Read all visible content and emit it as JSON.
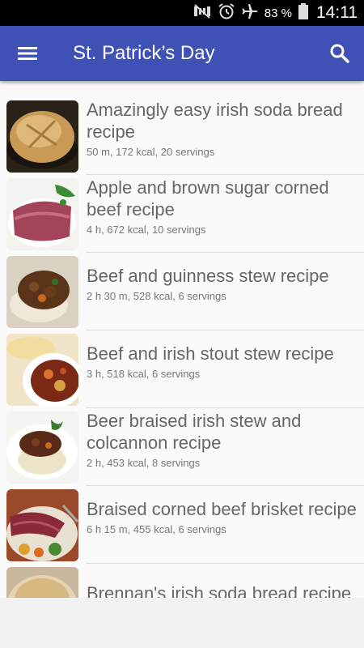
{
  "status_bar": {
    "battery_percent": "83 %",
    "time": "14:11",
    "icons": [
      "mute-icon",
      "alarm-icon",
      "airplane-icon",
      "battery-icon"
    ]
  },
  "app_bar": {
    "title": "St. Patrick’s Day",
    "menu_icon": "hamburger-menu-icon",
    "search_icon": "search-icon",
    "color": "#3f51b5"
  },
  "recipes": [
    {
      "title": "Amazingly easy irish soda bread recipe",
      "meta": "50 m, 172 kcal, 20 servings"
    },
    {
      "title": "Apple and brown sugar corned beef recipe",
      "meta": "4 h, 672 kcal, 10 servings"
    },
    {
      "title": "Beef and guinness stew recipe",
      "meta": "2 h 30 m, 528 kcal, 6 servings"
    },
    {
      "title": "Beef and irish stout stew recipe",
      "meta": "3 h, 518 kcal, 6 servings"
    },
    {
      "title": "Beer braised irish stew and colcannon recipe",
      "meta": "2 h, 453 kcal, 8 servings"
    },
    {
      "title": "Braised corned beef brisket recipe",
      "meta": "6 h 15 m, 455 kcal, 6 servings"
    },
    {
      "title": "Brennan's irish soda bread recipe",
      "meta": ""
    }
  ]
}
